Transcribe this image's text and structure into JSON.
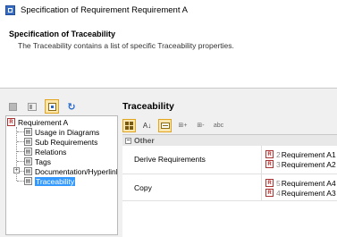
{
  "window": {
    "title": "Specification of Requirement Requirement A"
  },
  "header": {
    "title": "Specification of Traceability",
    "description": "The Traceability contains a list of specific Traceability properties."
  },
  "tree": {
    "root": "Requirement A",
    "items": [
      {
        "label": "Usage in Diagrams"
      },
      {
        "label": "Sub Requirements"
      },
      {
        "label": "Relations"
      },
      {
        "label": "Tags"
      },
      {
        "label": "Documentation/Hyperlinks"
      },
      {
        "label": "Traceability",
        "selected": true
      }
    ]
  },
  "panel": {
    "title": "Traceability",
    "group": "Other",
    "properties": [
      {
        "name": "Derive Requirements",
        "values": [
          {
            "num": "2",
            "label": "Requirement A1"
          },
          {
            "num": "3",
            "label": "Requirement A2"
          }
        ]
      },
      {
        "name": "Copy",
        "values": [
          {
            "num": "5",
            "label": "Requirement A4"
          },
          {
            "num": "4",
            "label": "Requirement A3"
          }
        ]
      }
    ]
  },
  "icons": {
    "requirement": "requirement-icon",
    "node": "element-node-icon"
  },
  "colors": {
    "selection": "#3399ff",
    "pressed_bg": "#fbe6b0"
  }
}
